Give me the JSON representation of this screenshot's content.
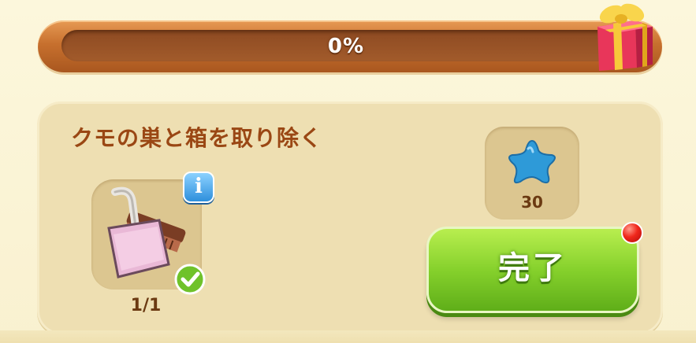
{
  "progress": {
    "label": "0%",
    "value_percent": 0
  },
  "gift_icon": "gift-box-icon",
  "task": {
    "title": "クモの巣と箱を取り除く",
    "tool": {
      "icon": "dustpan-brush-icon",
      "count": "1/1",
      "info_label": "i",
      "completed": true
    },
    "reward": {
      "icon": "blue-star-icon",
      "amount": "30"
    },
    "complete_button": "完了"
  },
  "colors": {
    "bar_orange": "#c7702e",
    "title_brown": "#9a4714",
    "button_green": "#86d12c",
    "star_blue": "#2e9ad8",
    "notify_red": "#f0281c"
  }
}
